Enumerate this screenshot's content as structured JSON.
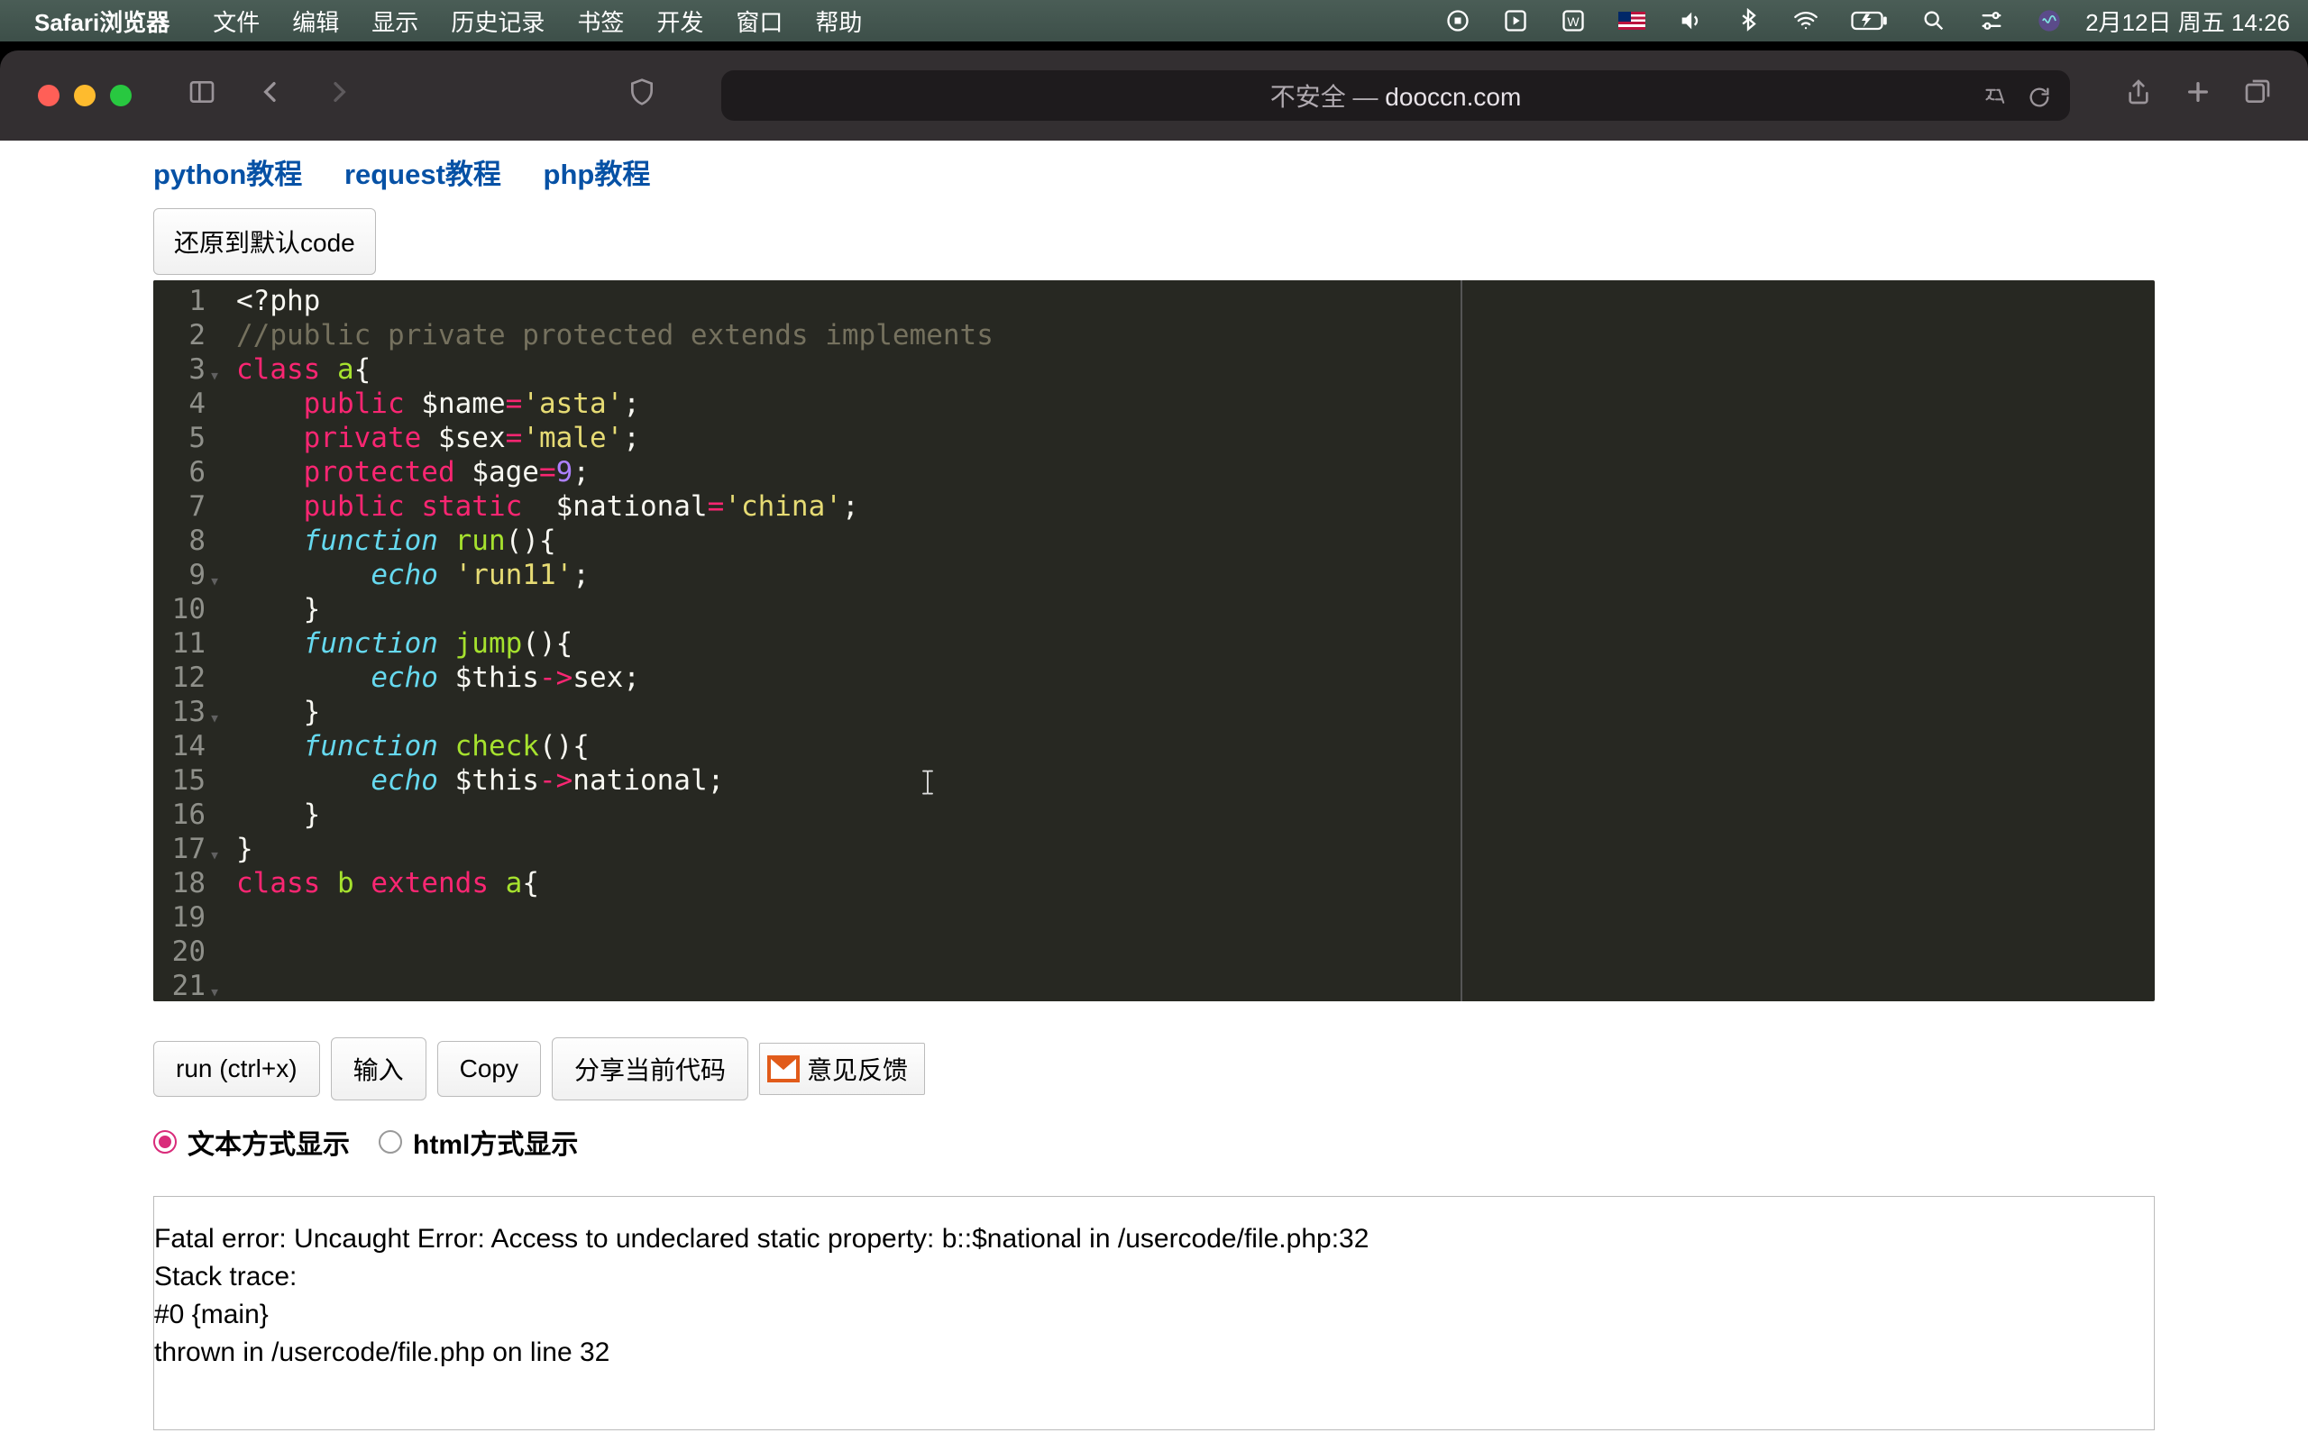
{
  "menubar": {
    "app": "Safari浏览器",
    "items": [
      "文件",
      "编辑",
      "显示",
      "历史记录",
      "书签",
      "开发",
      "窗口",
      "帮助"
    ],
    "clock": "2月12日 周五  14:26"
  },
  "browser": {
    "address_prefix": "不安全 — ",
    "address_host": "dooccn.com"
  },
  "page": {
    "links": [
      "python教程",
      "request教程",
      "php教程"
    ],
    "reset_btn": "还原到默认code",
    "buttons": {
      "run": "run (ctrl+x)",
      "input": "输入",
      "copy": "Copy",
      "share": "分享当前代码",
      "feedback": "意见反馈"
    },
    "radios": {
      "text_mode": "文本方式显示",
      "html_mode": "html方式显示"
    },
    "output": "Fatal error: Uncaught Error: Access to undeclared static property: b::$national in /usercode/file.php:32\nStack trace:\n#0 {main}\n  thrown in /usercode/file.php on line 32"
  },
  "editor": {
    "line_count": 21,
    "fold_lines": [
      3,
      9,
      13,
      17,
      21
    ],
    "code_lines": [
      {
        "t": [
          [
            "<?php",
            "var"
          ]
        ]
      },
      {
        "t": [
          [
            "//public private protected extends implements",
            "cmt"
          ]
        ]
      },
      {
        "t": [
          [
            "class",
            "kw2"
          ],
          [
            " ",
            "var"
          ],
          [
            "a",
            "name"
          ],
          [
            "{",
            "var"
          ]
        ]
      },
      {
        "t": [
          [
            "    ",
            "var"
          ],
          [
            "public",
            "kw2"
          ],
          [
            " ",
            "var"
          ],
          [
            "$name",
            "var"
          ],
          [
            "=",
            "op"
          ],
          [
            "'asta'",
            "str"
          ],
          [
            ";",
            "var"
          ]
        ]
      },
      {
        "t": [
          [
            "    ",
            "var"
          ],
          [
            "private",
            "kw2"
          ],
          [
            " ",
            "var"
          ],
          [
            "$sex",
            "var"
          ],
          [
            "=",
            "op"
          ],
          [
            "'male'",
            "str"
          ],
          [
            ";",
            "var"
          ]
        ]
      },
      {
        "t": [
          [
            "    ",
            "var"
          ],
          [
            "protected",
            "kw2"
          ],
          [
            " ",
            "var"
          ],
          [
            "$age",
            "var"
          ],
          [
            "=",
            "op"
          ],
          [
            "9",
            "num"
          ],
          [
            ";",
            "var"
          ]
        ]
      },
      {
        "t": [
          [
            "    ",
            "var"
          ],
          [
            "public",
            "kw2"
          ],
          [
            " ",
            "var"
          ],
          [
            "static",
            "kw2"
          ],
          [
            "  ",
            "var"
          ],
          [
            "$national",
            "var"
          ],
          [
            "=",
            "op"
          ],
          [
            "'china'",
            "str"
          ],
          [
            ";",
            "var"
          ]
        ]
      },
      {
        "t": [
          [
            "",
            "var"
          ]
        ]
      },
      {
        "t": [
          [
            "    ",
            "var"
          ],
          [
            "function",
            "decl"
          ],
          [
            " ",
            "var"
          ],
          [
            "run",
            "fn"
          ],
          [
            "(){",
            "var"
          ]
        ]
      },
      {
        "t": [
          [
            "        ",
            "var"
          ],
          [
            "echo",
            "decl"
          ],
          [
            " ",
            "var"
          ],
          [
            "'run11'",
            "str"
          ],
          [
            ";",
            "var"
          ]
        ]
      },
      {
        "t": [
          [
            "    }",
            "var"
          ]
        ]
      },
      {
        "t": [
          [
            "",
            "var"
          ]
        ]
      },
      {
        "t": [
          [
            "    ",
            "var"
          ],
          [
            "function",
            "decl"
          ],
          [
            " ",
            "var"
          ],
          [
            "jump",
            "fn"
          ],
          [
            "(){",
            "var"
          ]
        ]
      },
      {
        "t": [
          [
            "        ",
            "var"
          ],
          [
            "echo",
            "decl"
          ],
          [
            " ",
            "var"
          ],
          [
            "$this",
            "var"
          ],
          [
            "->",
            "op"
          ],
          [
            "sex;",
            "var"
          ]
        ]
      },
      {
        "t": [
          [
            "    }",
            "var"
          ]
        ]
      },
      {
        "t": [
          [
            "",
            "var"
          ]
        ]
      },
      {
        "t": [
          [
            "    ",
            "var"
          ],
          [
            "function",
            "decl"
          ],
          [
            " ",
            "var"
          ],
          [
            "check",
            "fn"
          ],
          [
            "(){",
            "var"
          ]
        ]
      },
      {
        "t": [
          [
            "        ",
            "var"
          ],
          [
            "echo",
            "decl"
          ],
          [
            " ",
            "var"
          ],
          [
            "$this",
            "var"
          ],
          [
            "->",
            "op"
          ],
          [
            "national;",
            "var"
          ]
        ]
      },
      {
        "t": [
          [
            "    }",
            "var"
          ]
        ]
      },
      {
        "t": [
          [
            "}",
            "var"
          ]
        ]
      },
      {
        "t": [
          [
            "class",
            "kw2"
          ],
          [
            " ",
            "var"
          ],
          [
            "b",
            "name"
          ],
          [
            " ",
            "var"
          ],
          [
            "extends",
            "kw2"
          ],
          [
            " ",
            "var"
          ],
          [
            "a",
            "name"
          ],
          [
            "{",
            "var"
          ]
        ]
      }
    ]
  }
}
